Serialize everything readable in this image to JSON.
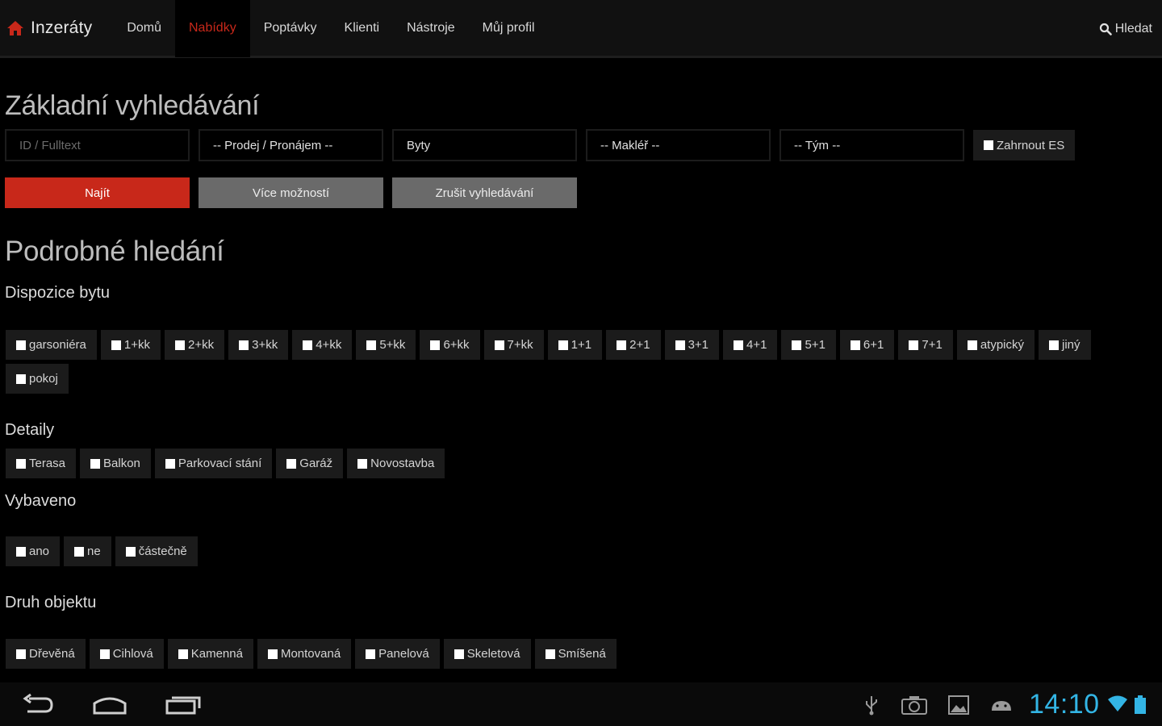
{
  "navbar": {
    "brand": "Inzeráty",
    "items": [
      {
        "label": "Domů",
        "active": false
      },
      {
        "label": "Nabídky",
        "active": true
      },
      {
        "label": "Poptávky",
        "active": false
      },
      {
        "label": "Klienti",
        "active": false
      },
      {
        "label": "Nástroje",
        "active": false
      },
      {
        "label": "Můj profil",
        "active": false
      }
    ],
    "search_label": "Hledat",
    "active_color": "#c8281a"
  },
  "basic_search": {
    "title": "Základní vyhledávání",
    "fulltext_placeholder": "ID / Fulltext",
    "sale_type": "-- Prodej / Pronájem --",
    "category": "Byty",
    "broker": "-- Makléř --",
    "team": "-- Tým --",
    "include_es": "Zahrnout ES",
    "find_button": "Najít",
    "more_options_button": "Více možností",
    "cancel_button": "Zrušit vyhledávání"
  },
  "detailed_search": {
    "title": "Podrobné hledání",
    "layout": {
      "label": "Dispozice bytu",
      "options": [
        "garsoniéra",
        "1+kk",
        "2+kk",
        "3+kk",
        "4+kk",
        "5+kk",
        "6+kk",
        "7+kk",
        "1+1",
        "2+1",
        "3+1",
        "4+1",
        "5+1",
        "6+1",
        "7+1",
        "atypický",
        "jiný",
        "pokoj"
      ]
    },
    "details": {
      "label": "Detaily",
      "options": [
        "Terasa",
        "Balkon",
        "Parkovací stání",
        "Garáž",
        "Novostavba"
      ]
    },
    "furnished": {
      "label": "Vybaveno",
      "options": [
        "ano",
        "ne",
        "částečně"
      ]
    },
    "building_type": {
      "label": "Druh objektu",
      "options": [
        "Dřevěná",
        "Cihlová",
        "Kamenná",
        "Montovaná",
        "Panelová",
        "Skeletová",
        "Smíšená"
      ]
    }
  },
  "system_bar": {
    "time": "14:10",
    "clock_color": "#33b5e5",
    "icons": [
      "back-icon",
      "home-icon",
      "recent-apps-icon",
      "usb-icon",
      "camera-icon",
      "gallery-icon",
      "android-icon",
      "wifi-icon",
      "battery-icon"
    ]
  }
}
